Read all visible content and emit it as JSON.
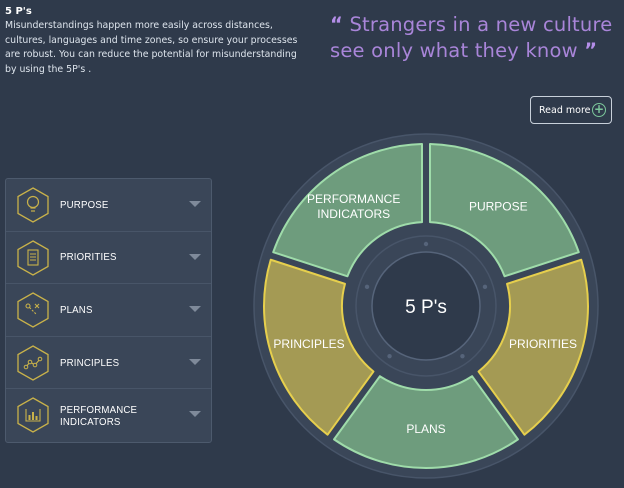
{
  "intro": {
    "title": "5 P's",
    "text": "Misunderstandings happen more easily across distances, cultures, languages and time zones, so ensure your processes are robust. You can reduce the potential for misunderstanding by using the 5P's ."
  },
  "quote": {
    "open_mark": "“",
    "line1": "Strangers in a new culture",
    "line2": "see only what they know",
    "close_mark": "”"
  },
  "read_more": {
    "label": "Read more",
    "icon": "plus-circle-icon"
  },
  "accordion": {
    "items": [
      {
        "label": "PURPOSE",
        "icon": "lightbulb-icon"
      },
      {
        "label": "PRIORITIES",
        "icon": "document-list-icon"
      },
      {
        "label": "PLANS",
        "icon": "plan-route-icon"
      },
      {
        "label": "PRINCIPLES",
        "icon": "connected-nodes-icon"
      },
      {
        "label": "PERFORMANCE INDICATORS",
        "icon": "bar-gauge-icon"
      }
    ]
  },
  "wheel": {
    "center_label": "5 P's",
    "segments": [
      {
        "label_lines": [
          "PURPOSE"
        ],
        "color": "green"
      },
      {
        "label_lines": [
          "PRIORITIES"
        ],
        "color": "yellow"
      },
      {
        "label_lines": [
          "PLANS"
        ],
        "color": "green"
      },
      {
        "label_lines": [
          "PRINCIPLES"
        ],
        "color": "yellow"
      },
      {
        "label_lines": [
          "PERFORMANCE",
          "INDICATORS"
        ],
        "color": "green"
      }
    ]
  },
  "colors": {
    "background": "#2f3a4b",
    "quote": "#a985d9",
    "hex_icon": "#c9b24a",
    "green_fill": "#6e9c7d",
    "green_stroke": "#9fdcaa",
    "yellow_fill": "#a49a54",
    "yellow_stroke": "#e6cf4d"
  }
}
